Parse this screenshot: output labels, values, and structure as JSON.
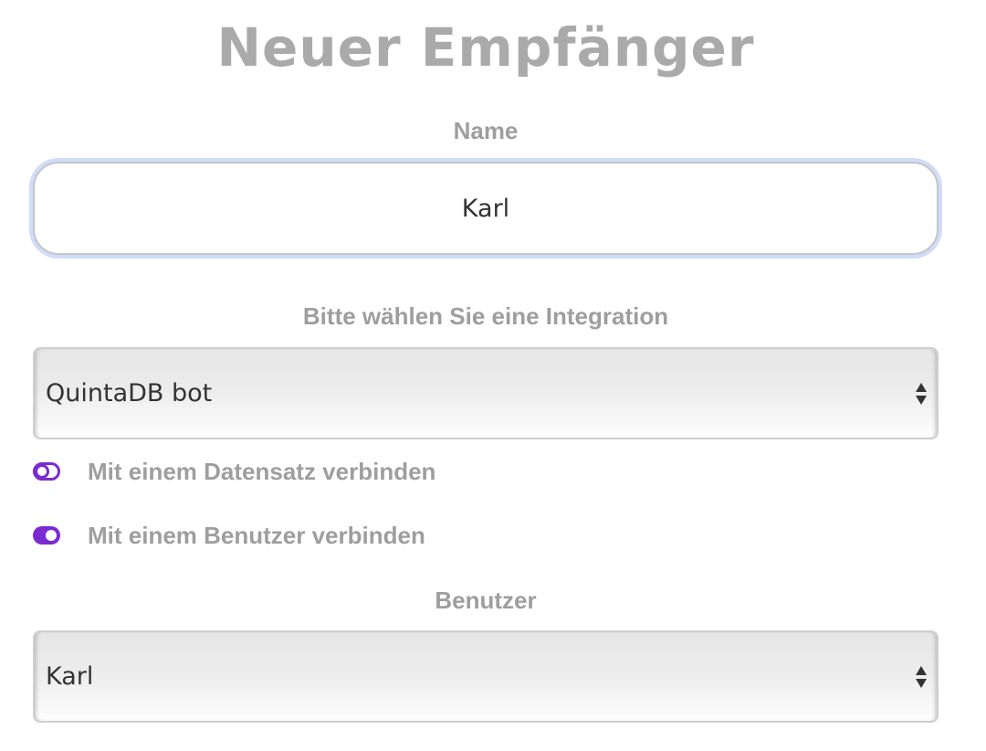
{
  "page": {
    "title": "Neuer Empfänger"
  },
  "name_field": {
    "label": "Name",
    "value": "Karl"
  },
  "integration": {
    "label": "Bitte wählen Sie eine Integration",
    "selected": "QuintaDB bot"
  },
  "toggles": [
    {
      "label": "Mit einem Datensatz verbinden",
      "checked": false
    },
    {
      "label": "Mit einem Benutzer verbinden",
      "checked": true
    }
  ],
  "user_select": {
    "label": "Benutzer",
    "selected": "Karl"
  },
  "colors": {
    "accent": "#7b2ad1",
    "label_gray": "#9e9e9e",
    "title_gray": "#aaaaaa",
    "focus_ring": "#cfdcfb"
  },
  "icons": {
    "select_arrows": "updown-chevron-icon",
    "toggle_off": "toggle-off-icon",
    "toggle_on": "toggle-on-icon"
  }
}
